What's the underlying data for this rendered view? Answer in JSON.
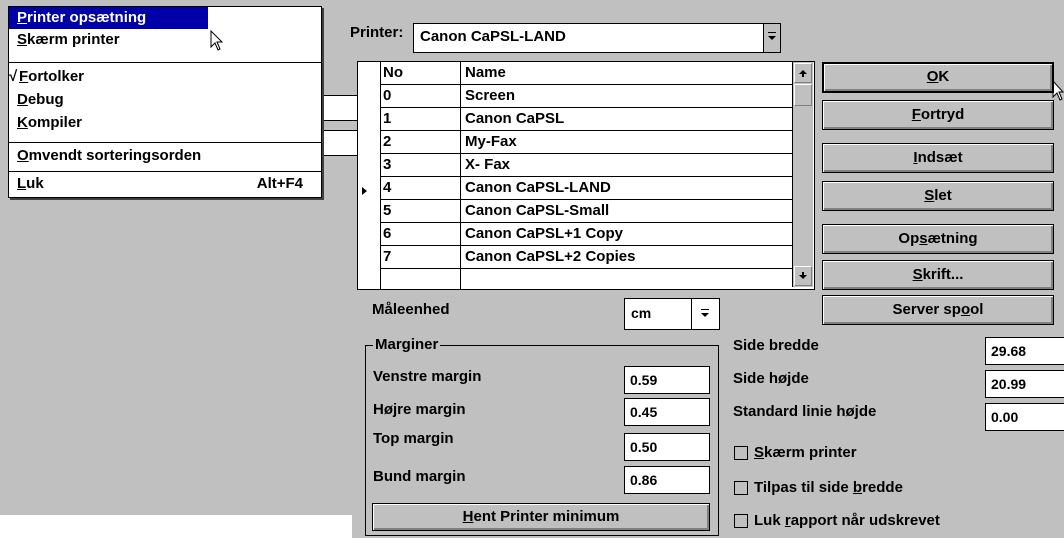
{
  "menu": {
    "items": [
      {
        "label": "Printer opsætning",
        "ul": "P",
        "rest": "rinter opsætning",
        "selected": true
      },
      {
        "label": "Skærm printer",
        "ul": "S",
        "rest": "kærm printer"
      },
      {
        "label": "Fortolker",
        "ul": "F",
        "rest": "ortolker",
        "checked": true
      },
      {
        "label": "Debug",
        "ul": "D",
        "rest": "ebug"
      },
      {
        "label": "Kompiler",
        "ul": "K",
        "rest": "ompiler"
      },
      {
        "label": "Omvendt sorteringsorden",
        "ul": "O",
        "rest": "mvendt sorteringsorden"
      },
      {
        "label": "Luk",
        "ul": "L",
        "rest": "uk",
        "shortcut": "Alt+F4"
      }
    ],
    "check_mark": "√"
  },
  "printer": {
    "label": "Printer:",
    "selected": "Canon CaPSL-LAND"
  },
  "grid": {
    "headers": [
      "No",
      "Name"
    ],
    "rows": [
      [
        "0",
        "Screen"
      ],
      [
        "1",
        "Canon CaPSL"
      ],
      [
        "2",
        "My-Fax"
      ],
      [
        "3",
        "X- Fax"
      ],
      [
        "4",
        "Canon CaPSL-LAND"
      ],
      [
        "5",
        "Canon CaPSL-Small"
      ],
      [
        "6",
        "Canon CaPSL+1 Copy"
      ],
      [
        "7",
        "Canon CaPSL+2 Copies"
      ],
      [
        "",
        ""
      ]
    ],
    "current_row_index": 4
  },
  "buttons": {
    "ok": {
      "ul": "O",
      "rest": "K"
    },
    "cancel": {
      "ul": "F",
      "rest": "ortryd"
    },
    "insert": {
      "ul": "I",
      "rest": "ndsæt"
    },
    "delete": {
      "pre": "",
      "ul": "S",
      "rest": "let"
    },
    "setup": {
      "pre": "Op",
      "ul": "s",
      "rest": "ætning"
    },
    "font": {
      "ul": "S",
      "rest": "krift..."
    },
    "spool": {
      "pre": "Server sp",
      "ul": "o",
      "rest": "ol"
    },
    "printer_min": {
      "ul": "H",
      "rest": "ent Printer minimum"
    }
  },
  "unit": {
    "label": "Måleenhed",
    "value": "cm"
  },
  "margins": {
    "legend": "Marginer",
    "left": {
      "label": "Venstre margin",
      "value": "0.59"
    },
    "right": {
      "label": "Højre margin",
      "value": "0.45"
    },
    "top": {
      "label": "Top margin",
      "value": "0.50"
    },
    "bottom": {
      "label": "Bund margin",
      "value": "0.86"
    }
  },
  "page": {
    "width": {
      "label": "Side bredde",
      "value": "29.68"
    },
    "height": {
      "label": "Side højde",
      "value": "20.99"
    },
    "line_height": {
      "label": "Standard linie højde",
      "value": "0.00"
    }
  },
  "checkboxes": {
    "screen_printer": {
      "ul": "S",
      "rest": "kærm printer",
      "checked": false
    },
    "fit_width": {
      "pre": "Tilpas til side ",
      "ul": "b",
      "rest": "redde",
      "checked": false
    },
    "close_report": {
      "pre": "Luk ",
      "ul": "r",
      "rest": "apport når udskrevet",
      "checked": false
    }
  }
}
